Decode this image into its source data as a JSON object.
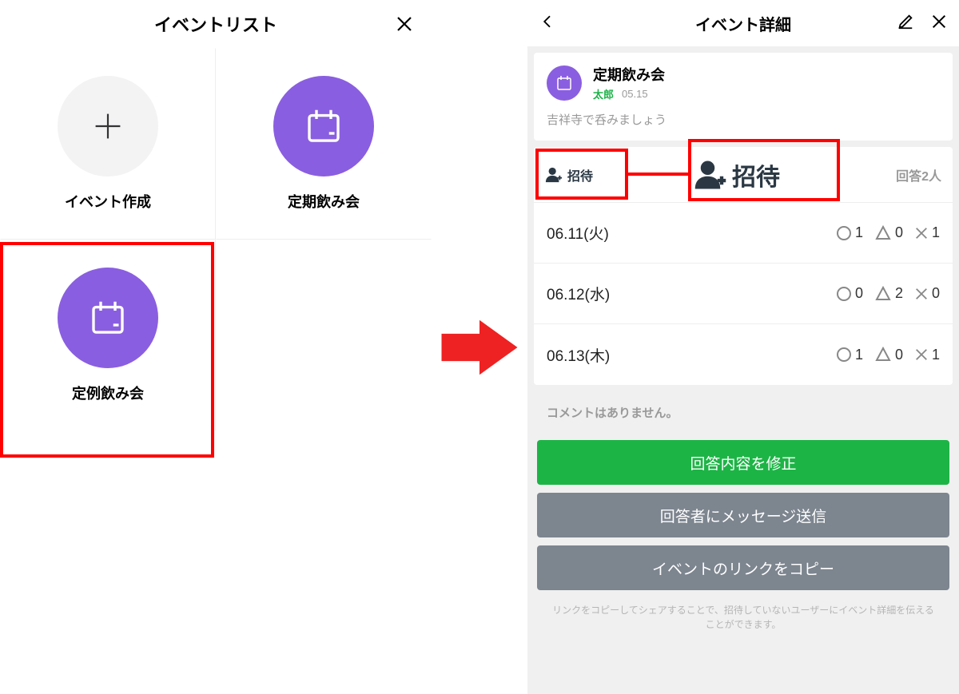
{
  "left": {
    "title": "イベントリスト",
    "cells": [
      {
        "label": "イベント作成"
      },
      {
        "label": "定期飲み会"
      },
      {
        "label": "定例飲み会"
      }
    ]
  },
  "right": {
    "title": "イベント詳細",
    "event": {
      "name": "定期飲み会",
      "author": "太郎",
      "posted": "05.15",
      "description": "吉祥寺で呑みましょう"
    },
    "invite": {
      "small": "招待",
      "big": "招待"
    },
    "answers": "回答2人",
    "dates": [
      {
        "label": "06.11(火)",
        "yes": "1",
        "maybe": "0",
        "no": "1"
      },
      {
        "label": "06.12(水)",
        "yes": "0",
        "maybe": "2",
        "no": "0"
      },
      {
        "label": "06.13(木)",
        "yes": "1",
        "maybe": "0",
        "no": "1"
      }
    ],
    "no_comments": "コメントはありません。",
    "buttons": {
      "edit_answer": "回答内容を修正",
      "send_msg": "回答者にメッセージ送信",
      "copy_link": "イベントのリンクをコピー"
    },
    "hint": "リンクをコピーしてシェアすることで、招待していないユーザーにイベント詳細を伝えることができます。"
  }
}
